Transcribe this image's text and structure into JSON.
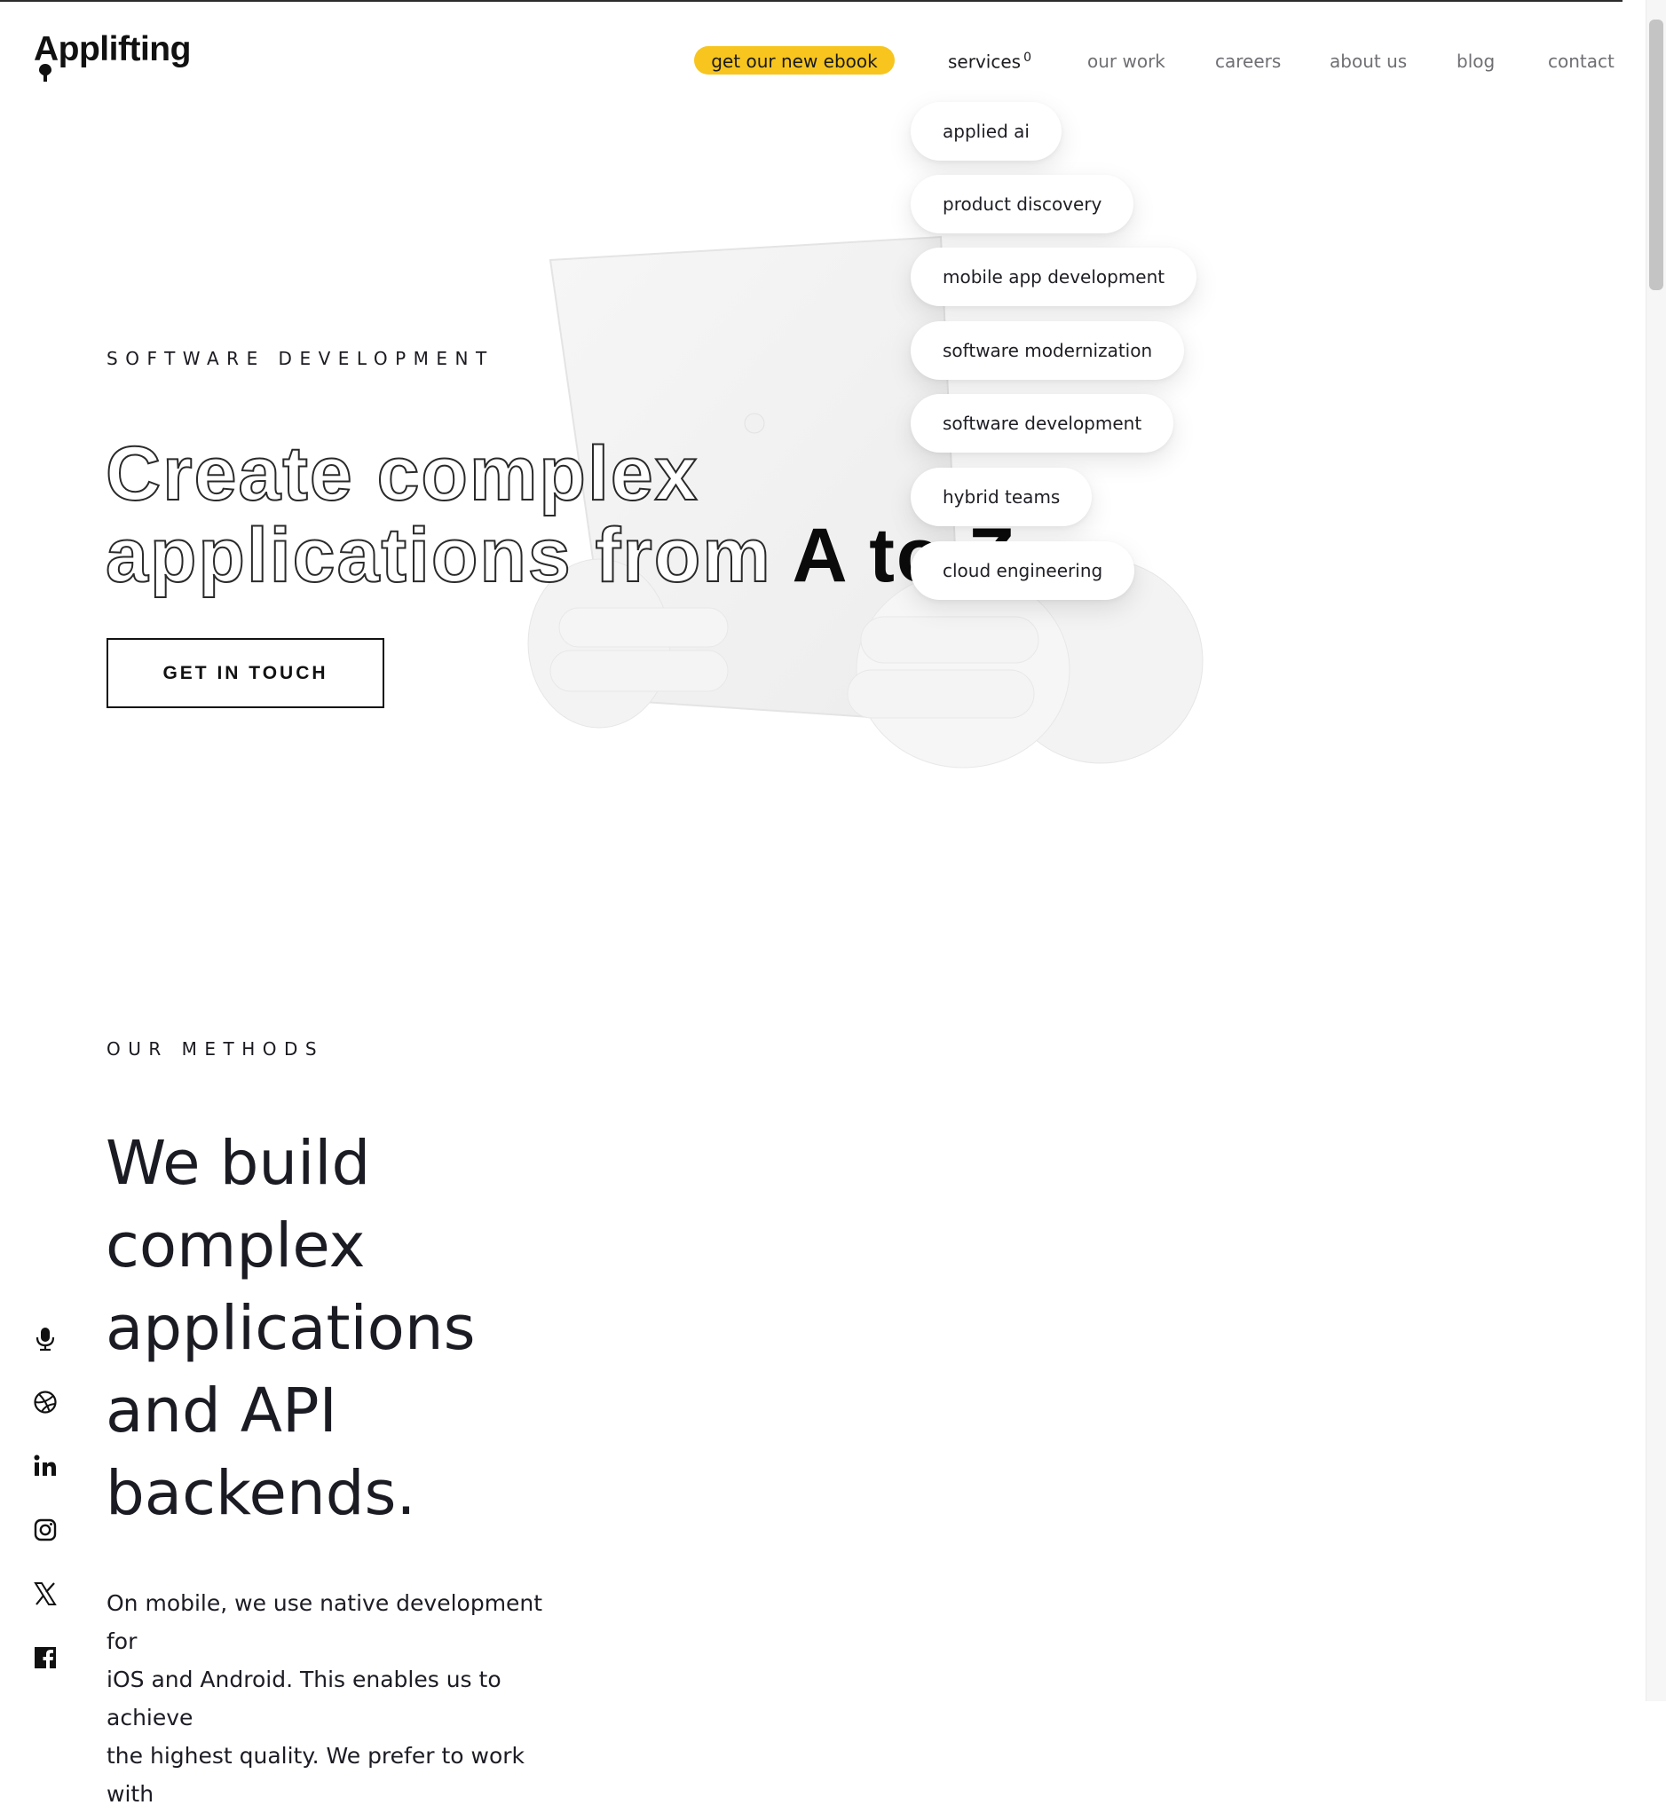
{
  "brand": {
    "name": "Applifting"
  },
  "nav": {
    "ebook": "get our new ebook",
    "items": [
      {
        "label": "services",
        "sup": "0"
      },
      {
        "label": "our work"
      },
      {
        "label": "careers"
      },
      {
        "label": "about us"
      },
      {
        "label": "blog"
      },
      {
        "label": "contact"
      }
    ]
  },
  "services_menu": [
    "applied ai",
    "product discovery",
    "mobile app development",
    "software modernization",
    "software development",
    "hybrid teams",
    "cloud engineering"
  ],
  "hero": {
    "eyebrow": "SOFTWARE DEVELOPMENT",
    "title_line1": "Create complex",
    "title_line2_outline": "applications from",
    "title_line2_solid": "A to Z",
    "cta": "GET IN TOUCH"
  },
  "methods": {
    "eyebrow": "OUR METHODS",
    "heading_lines": [
      "We build",
      "complex",
      "applications",
      "and API",
      "backends."
    ],
    "body_lines": [
      "On mobile, we use native development for",
      "iOS and Android. This enables us to achieve",
      "the highest quality. We prefer to work with"
    ]
  },
  "socials": [
    "microphone-icon",
    "dribbble-icon",
    "linkedin-icon",
    "instagram-icon",
    "x-icon",
    "facebook-icon"
  ],
  "colors": {
    "accent": "#f7c51e",
    "text": "#14141c",
    "muted": "#6f6f74"
  }
}
